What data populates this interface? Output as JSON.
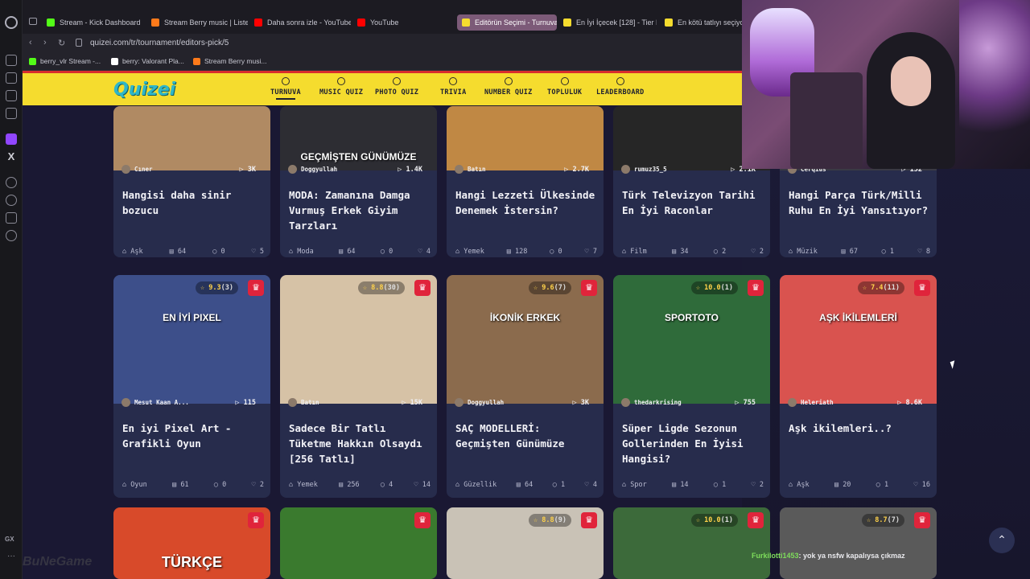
{
  "browser": {
    "tabs": [
      {
        "label": "Stream - Kick Dashboard",
        "color": "#53fc18"
      },
      {
        "label": "Stream Berry music | Liste",
        "color": "#ff7a1a"
      },
      {
        "label": "Daha sonra izle - YouTube",
        "color": "#ff0000"
      },
      {
        "label": "YouTube",
        "color": "#ff0000"
      },
      {
        "label": "Editörün Seçimi - Turnuva",
        "color": "#f5dc2e",
        "active": true
      },
      {
        "label": "En İyi İçecek [128] - Tier L",
        "color": "#f5dc2e"
      },
      {
        "label": "En kötü tatlıyı seçiyor",
        "color": "#f5dc2e"
      }
    ],
    "url": "quizei.com/tr/tournament/editors-pick/5",
    "bookmarks": [
      {
        "label": "berry_vlr Stream -...",
        "color": "#53fc18"
      },
      {
        "label": "berry: Valorant Pla...",
        "color": "#fff"
      },
      {
        "label": "Stream Berry musi...",
        "color": "#ff7a1a"
      }
    ]
  },
  "site": {
    "brand": "Quizei",
    "nav": [
      {
        "label": "TURNUVA",
        "active": true,
        "icon": "trophy-icon"
      },
      {
        "label": "MUSIC QUIZ",
        "icon": "music-note-icon"
      },
      {
        "label": "PHOTO QUIZ",
        "icon": "camera-icon"
      },
      {
        "label": "TRIVIA",
        "icon": "question-icon"
      },
      {
        "label": "NUMBER QUIZ",
        "icon": "hash-icon"
      },
      {
        "label": "TOPLULUK",
        "icon": "users-icon"
      },
      {
        "label": "LEADERBOARD",
        "icon": "award-icon"
      }
    ]
  },
  "cards": [
    {
      "creator": "Cıner",
      "plays": "3K",
      "title": "Hangisi daha sinir bozucu",
      "category": "Aşk",
      "items": "64",
      "comments": "0",
      "likes": "5",
      "img": "#b08a63"
    },
    {
      "creator": "Doggyullah",
      "plays": "1.4K",
      "title": "MODA: Zamanına Damga Vurmuş Erkek Giyim Tarzları",
      "category": "Moda",
      "items": "64",
      "comments": "0",
      "likes": "4",
      "img": "#2d2d33",
      "imgtext": "GEÇMİŞTEN GÜNÜMÜZE"
    },
    {
      "creator": "Batın",
      "plays": "2.7K",
      "title": "Hangi Lezzeti Ülkesinde Denemek İstersin?",
      "category": "Yemek",
      "items": "128",
      "comments": "0",
      "likes": "7",
      "img": "#c08844"
    },
    {
      "creator": "rumuz35_5",
      "plays": "2.1K",
      "title": "Türk Televizyon Tarihi En İyi Racon­lar",
      "category": "Film",
      "items": "34",
      "comments": "2",
      "likes": "2",
      "img": "#262626"
    },
    {
      "creator": "Cerqius",
      "plays": "152",
      "title": "Hangi Parça Türk/Milli Ruhu En İyi Yansıtıyor?",
      "category": "Müzik",
      "items": "67",
      "comments": "1",
      "likes": "8",
      "img": "#3a3a44"
    },
    {
      "creator": "Mesut Kaan A...",
      "plays": "115",
      "rating": "9.3",
      "ratingCount": "(3)",
      "title": "En iyi Pixel Art - Grafikli Oyun",
      "category": "Oyun",
      "items": "61",
      "comments": "0",
      "likes": "2",
      "img": "#3d4f8a",
      "imgtext": "EN İYİ PIXEL"
    },
    {
      "creator": "Batın",
      "plays": "15K",
      "rating": "8.8",
      "ratingCount": "(30)",
      "title": "Sadece Bir Tatlı Tüketme Hakkın Olsaydı [256 Tatlı]",
      "category": "Yemek",
      "items": "256",
      "comments": "4",
      "likes": "14",
      "img": "#d6c2a6"
    },
    {
      "creator": "Doggyullah",
      "plays": "3K",
      "rating": "9.6",
      "ratingCount": "(7)",
      "title": "SAÇ MODELLERİ: Geçmişten Günümüze",
      "category": "Güzellik",
      "items": "64",
      "comments": "1",
      "likes": "4",
      "img": "#8b6b4d",
      "imgtext": "İKONİK ERKEK"
    },
    {
      "creator": "thedarkrising",
      "plays": "755",
      "rating": "10.0",
      "ratingCount": "(1)",
      "title": "Süper Ligde Sezonun Gollerinden En İyisi Hangisi?",
      "category": "Spor",
      "items": "14",
      "comments": "1",
      "likes": "2",
      "img": "#2f6b3a",
      "imgtext": "SPORTOTO"
    },
    {
      "creator": "Heleriath",
      "plays": "8.6K",
      "rating": "7.4",
      "ratingCount": "(11)",
      "title": "Aşk ikilemleri..?",
      "category": "Aşk",
      "items": "20",
      "comments": "1",
      "likes": "16",
      "img": "#d9534f",
      "imgtext": "AŞK İKİLEMLERİ"
    },
    {
      "img": "#d84a2a",
      "imgtext": "TÜRKÇE"
    },
    {
      "img": "#3a7a2e"
    },
    {
      "rating": "8.8",
      "ratingCount": "(9)",
      "img": "#c9c2b6"
    },
    {
      "rating": "10.0",
      "ratingCount": "(1)",
      "img": "#3c6a3a"
    },
    {
      "rating": "8.7",
      "ratingCount": "(7)",
      "img": "#5a5a5a"
    }
  ],
  "chat": {
    "user": "Furkilotti1453",
    "message": ": yok ya nsfw kapalıysa çıkmaz"
  },
  "watermark": "BuNeGame"
}
